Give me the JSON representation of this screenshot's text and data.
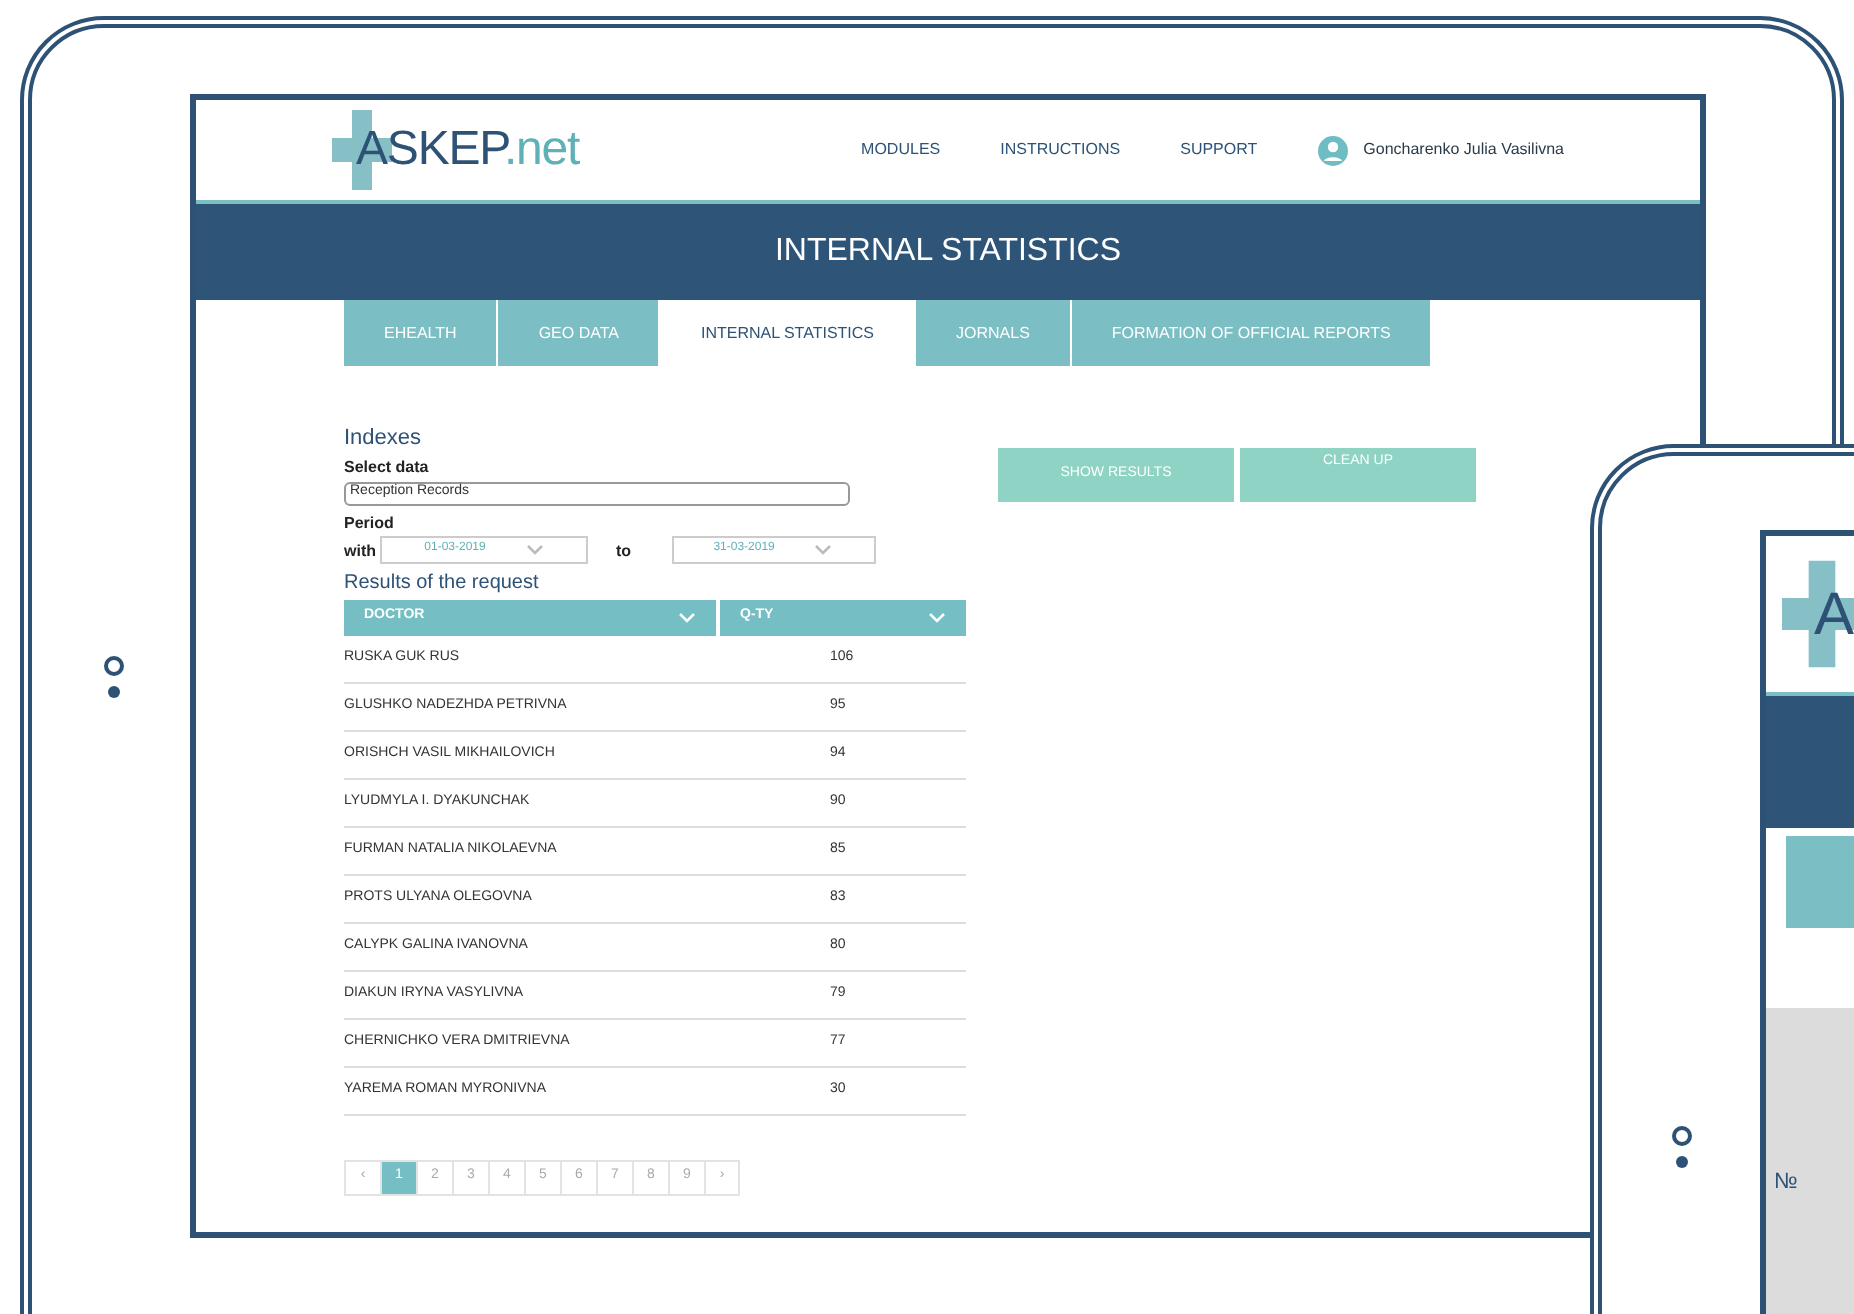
{
  "main_tablet": {
    "logo": {
      "name": "ASKEP",
      "suffix": ".net"
    },
    "nav": [
      "MODULES",
      "INSTRUCTIONS",
      "SUPPORT"
    ],
    "user": "Goncharenko Julia Vasilivna",
    "banner": "INTERNAL STATISTICS",
    "tabs": [
      {
        "label": "EHEALTH",
        "selected": false
      },
      {
        "label": "GEO DATA",
        "selected": false
      },
      {
        "label": "INTERNAL STATISTICS",
        "selected": true
      },
      {
        "label": "JORNALS",
        "selected": false
      },
      {
        "label": "FORMATION OF OFFICIAL REPORTS",
        "selected": false
      }
    ],
    "form": {
      "title": "Indexes",
      "select_label": "Select data",
      "select_value": "Reception Records",
      "period_label": "Period",
      "from_label": "with",
      "from_value": "01-03-2019",
      "to_label": "to",
      "to_value": "31-03-2019"
    },
    "buttons": [
      "SHOW RESULTS",
      "CLEAN UP"
    ],
    "results_title": "Results of the request",
    "table": {
      "columns": [
        "DOCTOR",
        "Q-TY"
      ],
      "rows": [
        [
          "RUSKA GUK RUS",
          "106"
        ],
        [
          "GLUSHKO NADEZHDA PETRIVNA",
          "95"
        ],
        [
          "ORISHCH VASIL MIKHAILOVICH",
          "94"
        ],
        [
          "LYUDMYLA I. DYAKUNCHAK",
          "90"
        ],
        [
          "FURMAN NATALIA NIKOLAEVNA",
          "85"
        ],
        [
          "PROTS ULYANA OLEGOVNA",
          "83"
        ],
        [
          "CALYPK GALINA IVANOVNA",
          "80"
        ],
        [
          "DIAKUN IRYNA VASYLIVNA",
          "79"
        ],
        [
          "CHERNICHKO VERA DMITRIEVNA",
          "77"
        ],
        [
          "YAREMA ROMAN MYRONIVNA",
          "30"
        ]
      ]
    },
    "pagination": {
      "prev": "‹",
      "pages": [
        {
          "label": "1",
          "selected": true
        },
        {
          "label": "2",
          "selected": false
        },
        {
          "label": "3",
          "selected": false
        },
        {
          "label": "4",
          "selected": false
        },
        {
          "label": "5",
          "selected": false
        },
        {
          "label": "6",
          "selected": false
        },
        {
          "label": "7",
          "selected": false
        },
        {
          "label": "8",
          "selected": false
        },
        {
          "label": "9",
          "selected": false
        }
      ],
      "next": "›"
    }
  },
  "second_tablet": {
    "logo_letter": "A",
    "number_sign": "№"
  }
}
